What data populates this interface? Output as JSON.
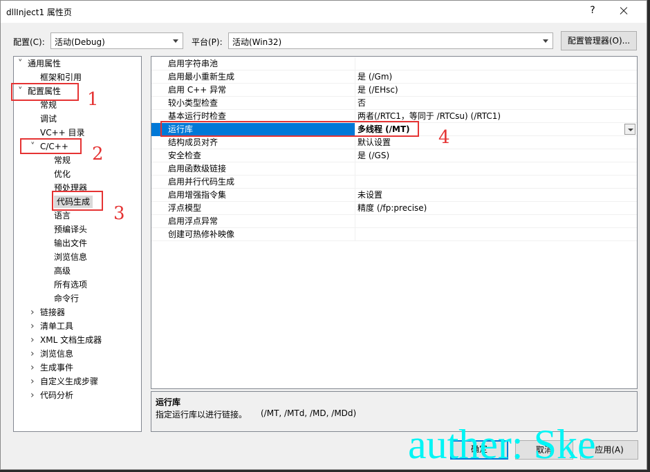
{
  "window": {
    "title": "dllInject1 属性页",
    "help_label": "?"
  },
  "config": {
    "config_label": "配置(C):",
    "config_value": "活动(Debug)",
    "platform_label": "平台(P):",
    "platform_value": "活动(Win32)",
    "manager_button": "配置管理器(O)..."
  },
  "tree": [
    {
      "label": "通用属性",
      "exp": "v",
      "level": 0
    },
    {
      "label": "框架和引用",
      "exp": "",
      "level": 1
    },
    {
      "label": "配置属性",
      "exp": "v",
      "level": 0
    },
    {
      "label": "常规",
      "exp": "",
      "level": 1
    },
    {
      "label": "调试",
      "exp": "",
      "level": 1
    },
    {
      "label": "VC++ 目录",
      "exp": "",
      "level": 1
    },
    {
      "label": "C/C++",
      "exp": "v",
      "level": 1
    },
    {
      "label": "常规",
      "exp": "",
      "level": 2
    },
    {
      "label": "优化",
      "exp": "",
      "level": 2
    },
    {
      "label": "预处理器",
      "exp": "",
      "level": 2
    },
    {
      "label": "代码生成",
      "exp": "",
      "level": 2,
      "selected": true
    },
    {
      "label": "语言",
      "exp": "",
      "level": 2
    },
    {
      "label": "预编译头",
      "exp": "",
      "level": 2
    },
    {
      "label": "输出文件",
      "exp": "",
      "level": 2
    },
    {
      "label": "浏览信息",
      "exp": "",
      "level": 2
    },
    {
      "label": "高级",
      "exp": "",
      "level": 2
    },
    {
      "label": "所有选项",
      "exp": "",
      "level": 2
    },
    {
      "label": "命令行",
      "exp": "",
      "level": 2
    },
    {
      "label": "链接器",
      "exp": ">",
      "level": 1
    },
    {
      "label": "清单工具",
      "exp": ">",
      "level": 1
    },
    {
      "label": "XML 文档生成器",
      "exp": ">",
      "level": 1
    },
    {
      "label": "浏览信息",
      "exp": ">",
      "level": 1
    },
    {
      "label": "生成事件",
      "exp": ">",
      "level": 1
    },
    {
      "label": "自定义生成步骤",
      "exp": ">",
      "level": 1
    },
    {
      "label": "代码分析",
      "exp": ">",
      "level": 1
    }
  ],
  "properties": [
    {
      "name": "启用字符串池",
      "value": ""
    },
    {
      "name": "启用最小重新生成",
      "value": "是 (/Gm)"
    },
    {
      "name": "启用 C++ 异常",
      "value": "是 (/EHsc)"
    },
    {
      "name": "较小类型检查",
      "value": "否"
    },
    {
      "name": "基本运行时检查",
      "value": "两者(/RTC1，等同于 /RTCsu) (/RTC1)"
    },
    {
      "name": "运行库",
      "value": "多线程 (/MT)",
      "selected": true
    },
    {
      "name": "结构成员对齐",
      "value": "默认设置"
    },
    {
      "name": "安全检查",
      "value": "是 (/GS)"
    },
    {
      "name": "启用函数级链接",
      "value": ""
    },
    {
      "name": "启用并行代码生成",
      "value": ""
    },
    {
      "name": "启用增强指令集",
      "value": "未设置"
    },
    {
      "name": "浮点模型",
      "value": "精度 (/fp:precise)"
    },
    {
      "name": "启用浮点异常",
      "value": ""
    },
    {
      "name": "创建可热修补映像",
      "value": ""
    }
  ],
  "description": {
    "title": "运行库",
    "text": "指定运行库以进行链接。",
    "flags": "(/MT, /MTd, /MD, /MDd)"
  },
  "buttons": {
    "ok": "确定",
    "cancel": "取消",
    "apply": "应用(A)"
  },
  "annotations": [
    "1",
    "2",
    "3",
    "4"
  ],
  "watermark": "auther: Ske",
  "colors": {
    "selection": "#0078d7",
    "annotation": "#e53333",
    "watermark": "#00f5f5"
  }
}
